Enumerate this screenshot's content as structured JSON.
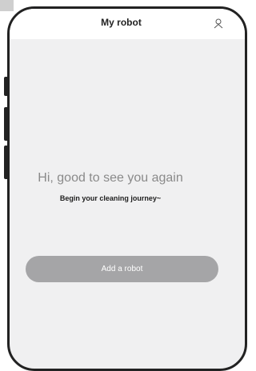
{
  "header": {
    "title": "My robot",
    "profile_icon": "user-icon"
  },
  "main": {
    "greeting": "Hi, good to see you again",
    "subtitle": "Begin your cleaning journey~",
    "add_robot_label": "Add a robot"
  },
  "colors": {
    "background": "#f0f0f1",
    "button": "#a5a5a7",
    "frame": "#222222"
  }
}
